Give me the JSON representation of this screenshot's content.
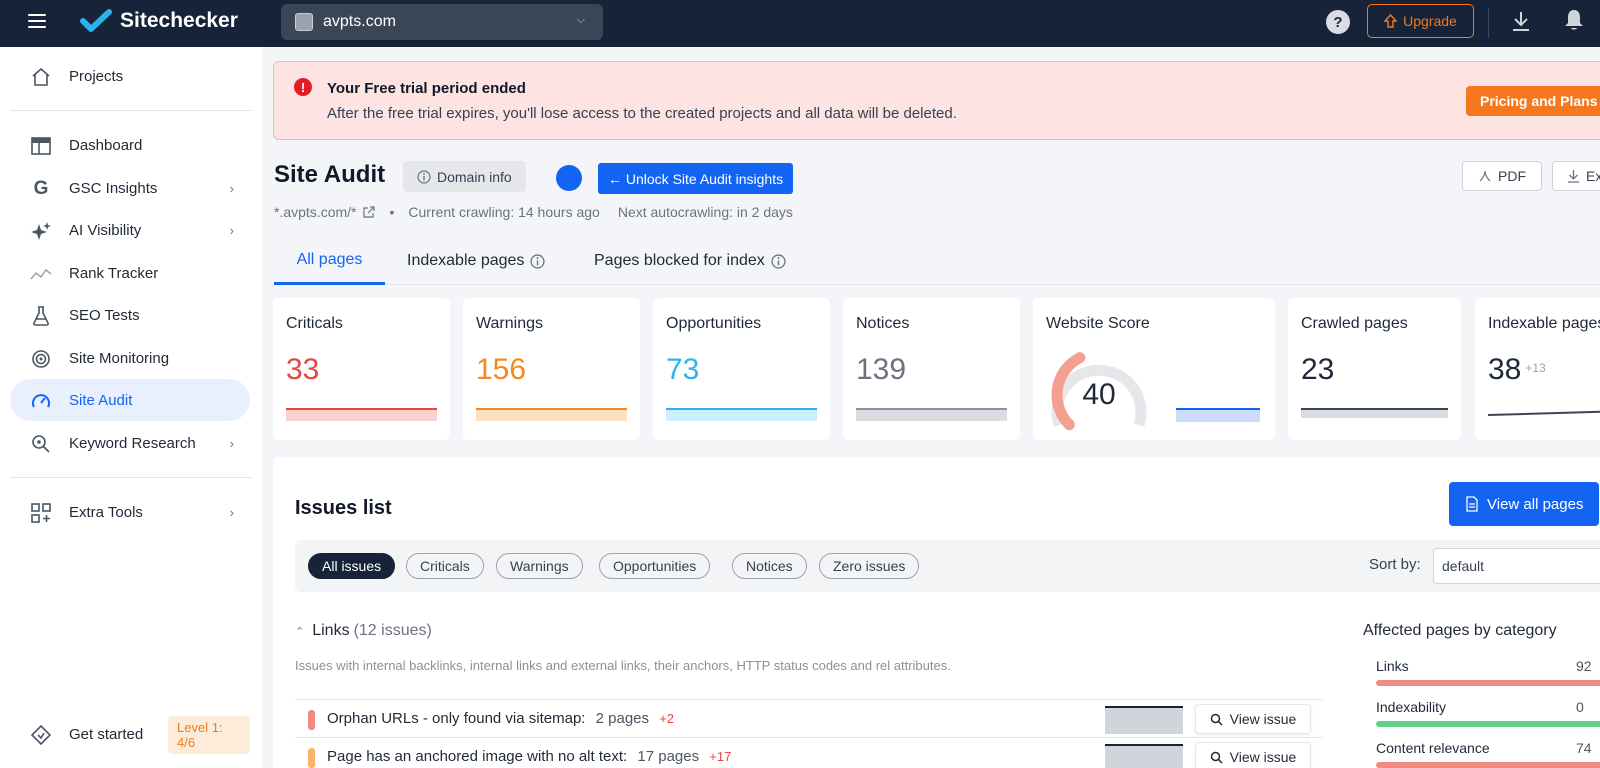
{
  "topbar": {
    "brand": "Sitechecker",
    "domain": "avpts.com",
    "upgrade_label": "Upgrade"
  },
  "sidebar": {
    "items": [
      {
        "label": "Projects",
        "icon": "home-icon"
      },
      {
        "label": "Dashboard",
        "icon": "dashboard-icon"
      },
      {
        "label": "GSC Insights",
        "icon": "google-icon"
      },
      {
        "label": "AI Visibility",
        "icon": "sparkle-icon"
      },
      {
        "label": "Rank Tracker",
        "icon": "rank-icon"
      },
      {
        "label": "SEO Tests",
        "icon": "flask-icon"
      },
      {
        "label": "Site Monitoring",
        "icon": "monitor-icon"
      },
      {
        "label": "Site Audit",
        "icon": "gauge-icon"
      },
      {
        "label": "Keyword Research",
        "icon": "keyword-icon"
      },
      {
        "label": "Extra Tools",
        "icon": "tools-icon"
      },
      {
        "label": "Get started",
        "icon": "diamond-icon"
      }
    ],
    "level_badge": "Level 1: 4/6"
  },
  "alert": {
    "title": "Your Free trial period ended",
    "text": "After the free trial expires, you'll lose access to the created projects and all data will be deleted.",
    "pricing_label": "Pricing and Plans"
  },
  "header": {
    "title": "Site Audit",
    "domain_info": "Domain info",
    "unlock_label": "← Unlock Site Audit insights",
    "pdf_label": "PDF",
    "export_label": "Ex",
    "scope": "*.avpts.com/*",
    "bullet": "•",
    "crawling": "Current crawling: 14 hours ago",
    "autocrawl": "Next autocrawling: in 2 days"
  },
  "tabs": [
    "All pages",
    "Indexable pages",
    "Pages blocked for index"
  ],
  "cards": [
    {
      "label": "Criticals",
      "value": "33",
      "color": "#e5483b"
    },
    {
      "label": "Warnings",
      "value": "156",
      "color": "#f5881f"
    },
    {
      "label": "Opportunities",
      "value": "73",
      "color": "#2bb3ea"
    },
    {
      "label": "Notices",
      "value": "139",
      "color": "#6b7280"
    },
    {
      "label": "Website Score",
      "value": "40",
      "score_fraction": 0.4
    },
    {
      "label": "Crawled pages",
      "value": "23"
    },
    {
      "label": "Indexable pages",
      "value": "38",
      "delta": "+13"
    }
  ],
  "issues": {
    "title": "Issues list",
    "view_all": "View all pages",
    "filters": [
      "All issues",
      "Criticals",
      "Warnings",
      "Opportunities",
      "Notices",
      "Zero issues"
    ],
    "sort_label": "Sort by:",
    "sort_value": "default",
    "group": {
      "name": "Links",
      "count": "(12 issues)",
      "description": "Issues with internal backlinks, internal links and external links, their anchors, HTTP status codes and rel attributes."
    },
    "rows": [
      {
        "text": "Orphan URLs - only found via sitemap:",
        "pages": "2 pages",
        "delta": "+2",
        "color": "#f28b82"
      },
      {
        "text": "Page has an anchored image with no alt text:",
        "pages": "17 pages",
        "delta": "+17",
        "color": "#f9b36b"
      }
    ],
    "view_issue": "View issue"
  },
  "affected": {
    "title": "Affected pages by category",
    "rows": [
      {
        "label": "Links",
        "value": "92",
        "color": "#f28b82"
      },
      {
        "label": "Indexability",
        "value": "0",
        "color": "#5fd28a"
      },
      {
        "label": "Content relevance",
        "value": "74",
        "color": "#f28b82"
      }
    ]
  }
}
